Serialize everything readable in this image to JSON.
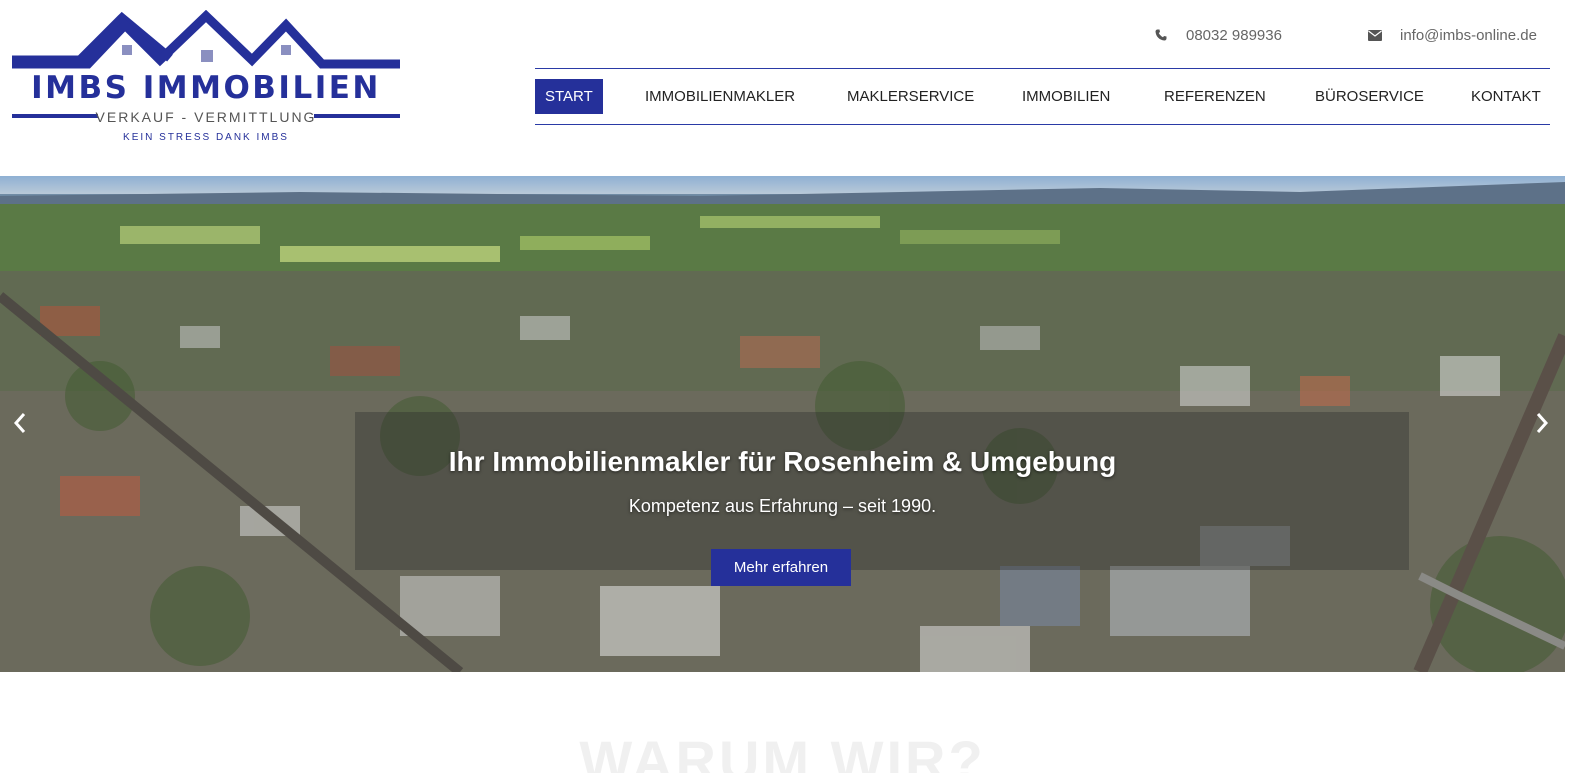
{
  "logo": {
    "brand": "IMBS IMMOBILIEN",
    "tagline": "VERKAUF - VERMITTLUNG",
    "slogan": "KEIN STRESS DANK IMBS",
    "color": "#25309a"
  },
  "contact": {
    "phone_icon": "phone-icon",
    "phone": "08032 989936",
    "email_icon": "envelope-icon",
    "email": "info@imbs-online.de"
  },
  "nav": {
    "items": [
      {
        "label": "START",
        "active": true
      },
      {
        "label": "IMMOBILIENMAKLER"
      },
      {
        "label": "MAKLERSERVICE"
      },
      {
        "label": "IMMOBILIEN"
      },
      {
        "label": "REFERENZEN"
      },
      {
        "label": "BÜROSERVICE"
      },
      {
        "label": "KONTAKT"
      }
    ],
    "accent": "#25309a"
  },
  "hero": {
    "headline": "Ihr Immobilienmakler für Rosenheim & Umgebung",
    "subline": "Kompetenz aus Erfahrung – seit 1990.",
    "button": "Mehr erfahren",
    "prev_icon": "chevron-left-icon",
    "next_icon": "chevron-right-icon"
  },
  "section": {
    "title": "WARUM WIR?"
  }
}
